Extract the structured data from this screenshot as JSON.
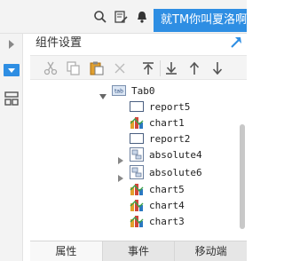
{
  "header": {
    "user_label": "就TM你叫夏洛啊",
    "icons": [
      "search-icon",
      "edit-document-icon",
      "bell-icon",
      "info-icon"
    ]
  },
  "panel": {
    "title": "组件设置",
    "pin_icon": "pin-icon"
  },
  "toolbar": {
    "tools": [
      "cut-icon",
      "copy-icon",
      "paste-icon",
      "delete-icon",
      "move-top-icon",
      "move-bottom-icon",
      "move-up-icon",
      "move-down-icon"
    ]
  },
  "tree": {
    "root": {
      "label": "Tab0",
      "badge": "tab",
      "expanded": true
    },
    "items": [
      {
        "label": "report5",
        "type": "report"
      },
      {
        "label": "chart1",
        "type": "chart"
      },
      {
        "label": "report2",
        "type": "report"
      },
      {
        "label": "absolute4",
        "type": "absolute",
        "expandable": true
      },
      {
        "label": "absolute6",
        "type": "absolute",
        "expandable": true
      },
      {
        "label": "chart5",
        "type": "chart"
      },
      {
        "label": "chart4",
        "type": "chart"
      },
      {
        "label": "chart3",
        "type": "chart"
      }
    ]
  },
  "bottom_tabs": [
    {
      "label": "属性",
      "active": true
    },
    {
      "label": "事件",
      "active": false
    },
    {
      "label": "移动端",
      "active": false
    }
  ],
  "colors": {
    "accent": "#2e8ee3",
    "toolbar_icon_disabled": "#bbbbbb",
    "toolbar_icon_enabled": "#555555"
  }
}
